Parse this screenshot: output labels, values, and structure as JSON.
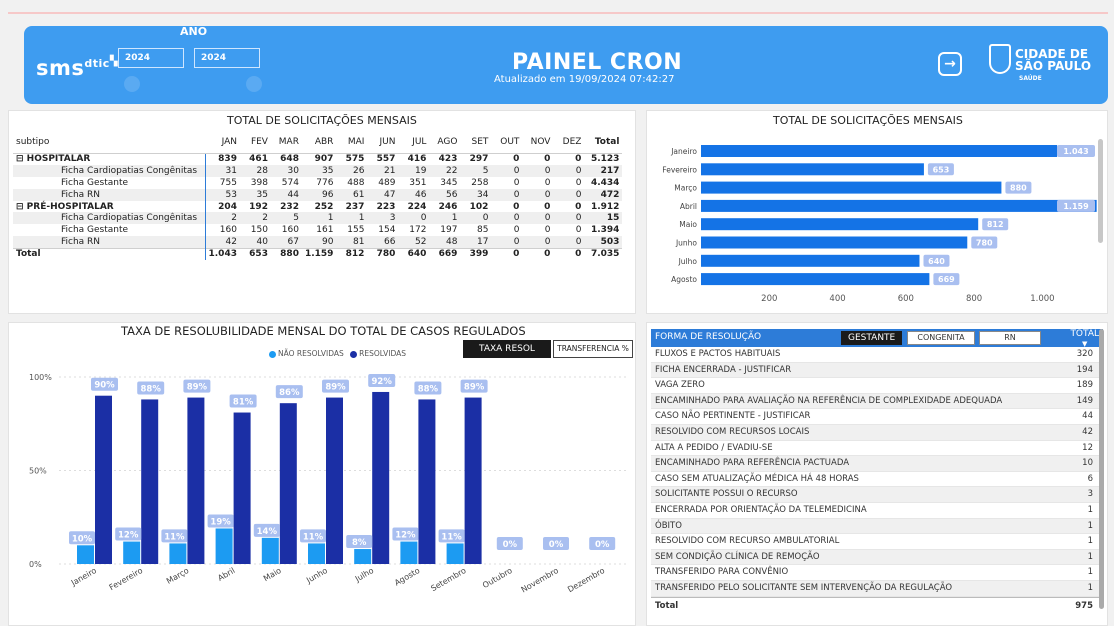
{
  "header": {
    "logo_main": "sms",
    "logo_sup": "dtic",
    "ano_label": "ANO",
    "year_from": "2024",
    "year_to": "2024",
    "title": "PAINEL CRON",
    "updated": "Atualizado em 19/09/2024 07:42:27",
    "cidade_line1": "CIDADE DE",
    "cidade_line2": "SÃO PAULO",
    "cidade_line3": "SAÚDE",
    "exit_icon": "exit-arrow-icon",
    "brand_color": "#3e9cf0"
  },
  "matrix": {
    "title": "TOTAL DE SOLICITAÇÕES MENSAIS",
    "col_label": "subtipo",
    "months": [
      "JAN",
      "FEV",
      "MAR",
      "ABR",
      "MAI",
      "JUN",
      "JUL",
      "AGO",
      "SET",
      "OUT",
      "NOV",
      "DEZ"
    ],
    "total_label": "Total",
    "rows": [
      {
        "label": "⊟ HOSPITALAR",
        "type": "grp",
        "values": [
          "839",
          "461",
          "648",
          "907",
          "575",
          "557",
          "416",
          "423",
          "297",
          "0",
          "0",
          "0"
        ],
        "total": "5.123"
      },
      {
        "label": "Ficha Cardiopatias Congênitas",
        "type": "sub",
        "values": [
          "31",
          "28",
          "30",
          "35",
          "26",
          "21",
          "19",
          "22",
          "5",
          "0",
          "0",
          "0"
        ],
        "total": "217"
      },
      {
        "label": "Ficha Gestante",
        "type": "sub",
        "values": [
          "755",
          "398",
          "574",
          "776",
          "488",
          "489",
          "351",
          "345",
          "258",
          "0",
          "0",
          "0"
        ],
        "total": "4.434"
      },
      {
        "label": "Ficha RN",
        "type": "sub",
        "values": [
          "53",
          "35",
          "44",
          "96",
          "61",
          "47",
          "46",
          "56",
          "34",
          "0",
          "0",
          "0"
        ],
        "total": "472"
      },
      {
        "label": "⊟ PRÉ-HOSPITALAR",
        "type": "grp",
        "values": [
          "204",
          "192",
          "232",
          "252",
          "237",
          "223",
          "224",
          "246",
          "102",
          "0",
          "0",
          "0"
        ],
        "total": "1.912"
      },
      {
        "label": "Ficha Cardiopatias Congênitas",
        "type": "sub",
        "values": [
          "2",
          "2",
          "5",
          "1",
          "1",
          "3",
          "0",
          "1",
          "0",
          "0",
          "0",
          "0"
        ],
        "total": "15"
      },
      {
        "label": "Ficha Gestante",
        "type": "sub",
        "values": [
          "160",
          "150",
          "160",
          "161",
          "155",
          "154",
          "172",
          "197",
          "85",
          "0",
          "0",
          "0"
        ],
        "total": "1.394"
      },
      {
        "label": "Ficha RN",
        "type": "sub",
        "values": [
          "42",
          "40",
          "67",
          "90",
          "81",
          "66",
          "52",
          "48",
          "17",
          "0",
          "0",
          "0"
        ],
        "total": "503"
      },
      {
        "label": "Total",
        "type": "tot",
        "values": [
          "1.043",
          "653",
          "880",
          "1.159",
          "812",
          "780",
          "640",
          "669",
          "399",
          "0",
          "0",
          "0"
        ],
        "total": "7.035"
      }
    ]
  },
  "chart_data": [
    {
      "type": "bar",
      "orientation": "horizontal",
      "title": "TOTAL DE SOLICITAÇÕES MENSAIS",
      "categories": [
        "Janeiro",
        "Fevereiro",
        "Março",
        "Abril",
        "Maio",
        "Junho",
        "Julho",
        "Agosto"
      ],
      "values": [
        1043,
        653,
        880,
        1159,
        812,
        780,
        640,
        669
      ],
      "value_labels": [
        "1.043",
        "653",
        "880",
        "1.159",
        "812",
        "780",
        "640",
        "669"
      ],
      "xticks": [
        200,
        400,
        600,
        800,
        1000
      ],
      "xtick_labels": [
        "200",
        "400",
        "600",
        "800",
        "1.000"
      ],
      "xlim": [
        0,
        1160
      ],
      "color": "#1473e6",
      "label_color": "#a9bff0"
    },
    {
      "type": "bar",
      "title": "TAXA DE RESOLUBILIDADE MENSAL DO TOTAL DE CASOS REGULADOS",
      "categories": [
        "Janeiro",
        "Fevereiro",
        "Março",
        "Abril",
        "Maio",
        "Junho",
        "Julho",
        "Agosto",
        "Setembro",
        "Outubro",
        "Novembro",
        "Dezembro"
      ],
      "series": [
        {
          "name": "NÃO RESOLVIDAS",
          "values": [
            10,
            12,
            11,
            19,
            14,
            11,
            8,
            12,
            11,
            0,
            0,
            0
          ],
          "labels": [
            "10%",
            "12%",
            "11%",
            "19%",
            "14%",
            "11%",
            "8%",
            "12%",
            "11%",
            "0%",
            "0%",
            "0%"
          ],
          "color": "#1c9bf2"
        },
        {
          "name": "RESOLVIDAS",
          "values": [
            90,
            88,
            89,
            81,
            86,
            89,
            92,
            88,
            89,
            null,
            null,
            null
          ],
          "labels": [
            "90%",
            "88%",
            "89%",
            "81%",
            "86%",
            "89%",
            "92%",
            "88%",
            "89%",
            "",
            "",
            ""
          ],
          "color": "#1b2fa5"
        }
      ],
      "yticks": [
        0,
        50,
        100
      ],
      "ytick_labels": [
        "0%",
        "50%",
        "100%"
      ],
      "ylim": [
        0,
        100
      ],
      "legend_position": "top-center",
      "label_bg": "#a9bff0"
    }
  ],
  "taxa": {
    "btn_taxa": "TAXA RESOL",
    "btn_transf": "TRANSFERENCIA %"
  },
  "resolucao": {
    "header_label": "FORMA DE RESOLUÇÃO",
    "header_total": "TOTAL",
    "toggle_gestante": "GESTANTE",
    "toggle_congenita": "CONGENITA",
    "toggle_rn": "RN",
    "rows": [
      {
        "label": "FLUXOS E PACTOS HABITUAIS",
        "value": "320"
      },
      {
        "label": "FICHA ENCERRADA - JUSTIFICAR",
        "value": "194"
      },
      {
        "label": "VAGA ZERO",
        "value": "189"
      },
      {
        "label": "ENCAMINHADO PARA AVALIAÇÃO NA REFERÊNCIA DE COMPLEXIDADE ADEQUADA",
        "value": "149"
      },
      {
        "label": "CASO NÃO PERTINENTE - JUSTIFICAR",
        "value": "44"
      },
      {
        "label": "RESOLVIDO COM RECURSOS LOCAIS",
        "value": "42"
      },
      {
        "label": "ALTA A PEDIDO / EVADIU-SE",
        "value": "12"
      },
      {
        "label": "ENCAMINHADO PARA REFERÊNCIA PACTUADA",
        "value": "10"
      },
      {
        "label": "CASO SEM ATUALIZAÇÃO MÉDICA HÁ 48 HORAS",
        "value": "6"
      },
      {
        "label": "SOLICITANTE POSSUI O RECURSO",
        "value": "3"
      },
      {
        "label": "ENCERRADA POR ORIENTAÇÃO DA TELEMEDICINA",
        "value": "1"
      },
      {
        "label": "ÓBITO",
        "value": "1"
      },
      {
        "label": "RESOLVIDO COM RECURSO AMBULATORIAL",
        "value": "1"
      },
      {
        "label": "SEM CONDIÇÃO CLÍNICA DE REMOÇÃO",
        "value": "1"
      },
      {
        "label": "TRANSFERIDO PARA CONVÊNIO",
        "value": "1"
      },
      {
        "label": "TRANSFERIDO PELO SOLICITANTE SEM INTERVENÇÃO DA REGULAÇÃO",
        "value": "1"
      }
    ],
    "total_label": "Total",
    "total_value": "975"
  }
}
